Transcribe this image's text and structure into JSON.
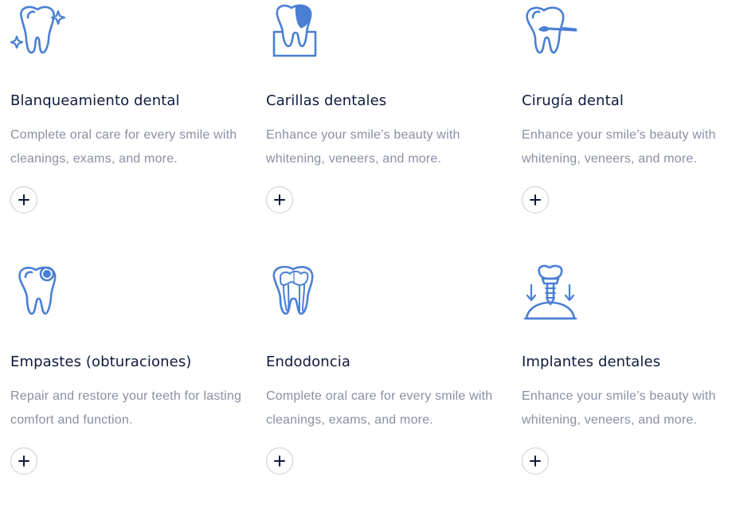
{
  "colors": {
    "accent": "#4a7fd4",
    "title": "#0f1b3d",
    "text": "#8a8fa3",
    "border": "#c9ccd6"
  },
  "services": [
    {
      "icon": "tooth-sparkle-icon",
      "title": "Blanqueamiento dental",
      "description": "Complete oral care for every smile with cleanings, exams, and more."
    },
    {
      "icon": "tooth-veneer-icon",
      "title": "Carillas dentales",
      "description": "Enhance your smile’s beauty with whitening, veneers, and more."
    },
    {
      "icon": "tooth-scalpel-icon",
      "title": "Cirugía dental",
      "description": "Enhance your smile’s beauty with whitening, veneers, and more."
    },
    {
      "icon": "tooth-filling-icon",
      "title": "Empastes (obturaciones)",
      "description": "Repair and restore your teeth for lasting comfort and function."
    },
    {
      "icon": "tooth-root-canal-icon",
      "title": "Endodoncia",
      "description": "Complete oral care for every smile with cleanings, exams, and more."
    },
    {
      "icon": "dental-implant-icon",
      "title": "Implantes dentales",
      "description": "Enhance your smile’s beauty with whitening, veneers, and more."
    }
  ],
  "expand_icon": "plus-icon"
}
